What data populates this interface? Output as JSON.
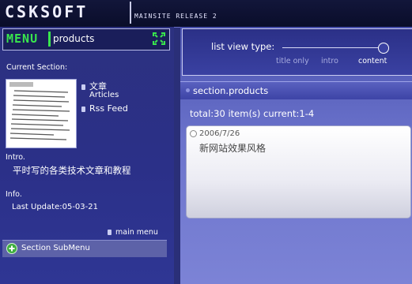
{
  "header": {
    "logo": "CSKSOFT",
    "release": "MAINSITE RELEASE 2"
  },
  "left": {
    "menu_label": "MENU",
    "menu_value": "products",
    "current_section_label": "Current Section:",
    "links": [
      {
        "label": "文章",
        "sub": "Articles"
      },
      {
        "label": "Rss Feed"
      }
    ],
    "intro_label": "Intro.",
    "intro_text": "平时写的各类技术文章和教程",
    "info_label": "Info.",
    "last_update": "Last Update:05-03-21",
    "main_menu": "main menu",
    "submenu_label": "Section SubMenu"
  },
  "right": {
    "view_type_label": "list view type:",
    "view_options": [
      "title only",
      "intro",
      "content"
    ],
    "view_selected": "content",
    "section_title": "section.products",
    "total": "total:30 item(s) current:1-4",
    "items": [
      {
        "date": "2006/7/26",
        "title": "新网站效果风格"
      }
    ]
  },
  "colors": {
    "accent_green": "#39e64d",
    "panel_blue": "#2c3180",
    "content_blue": "#6c74cc"
  }
}
